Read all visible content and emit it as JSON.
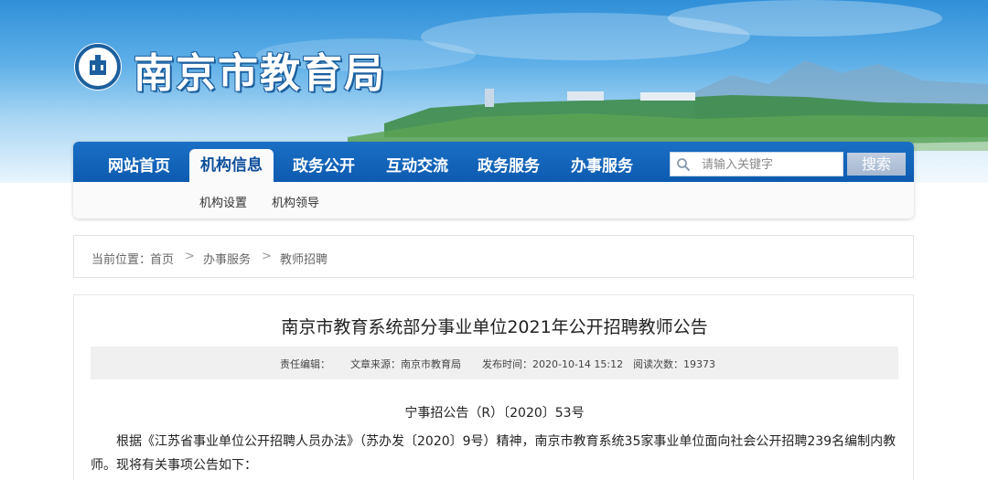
{
  "site": {
    "title": "南京市教育局",
    "logo_icon": "bureau-emblem-icon"
  },
  "nav": {
    "items": [
      {
        "label": "网站首页",
        "active": false
      },
      {
        "label": "机构信息",
        "active": true
      },
      {
        "label": "政务公开",
        "active": false
      },
      {
        "label": "互动交流",
        "active": false
      },
      {
        "label": "政务服务",
        "active": false
      },
      {
        "label": "办事服务",
        "active": false
      }
    ],
    "subitems": [
      {
        "label": "机构设置"
      },
      {
        "label": "机构领导"
      }
    ],
    "search": {
      "placeholder": "请输入关键字",
      "button_label": "搜索",
      "icon": "search-icon"
    }
  },
  "breadcrumb": {
    "prefix": "当前位置：",
    "items": [
      {
        "label": "首页"
      },
      {
        "label": "办事服务"
      },
      {
        "label": "教师招聘"
      }
    ],
    "separator": ">"
  },
  "article": {
    "title": "南京市教育系统部分事业单位2021年公开招聘教师公告",
    "meta": {
      "editor": "责任编辑：",
      "source": "文章来源：南京市教育局",
      "published": "发布时间：2020-10-14 15:12",
      "views": "阅读次数：19373"
    },
    "doc_number": "宁事招公告（R）〔2020〕53号",
    "paragraph": "根据《江苏省事业单位公开招聘人员办法》（苏办发〔2020〕9号）精神，南京市教育系统35家事业单位面向社会公开招聘239名编制内教师。现将有关事项公告如下："
  },
  "colors": {
    "nav_blue": "#0d5bb0",
    "active_tab_text": "#0d4f9c",
    "meta_bar": "#f0f0f0"
  }
}
